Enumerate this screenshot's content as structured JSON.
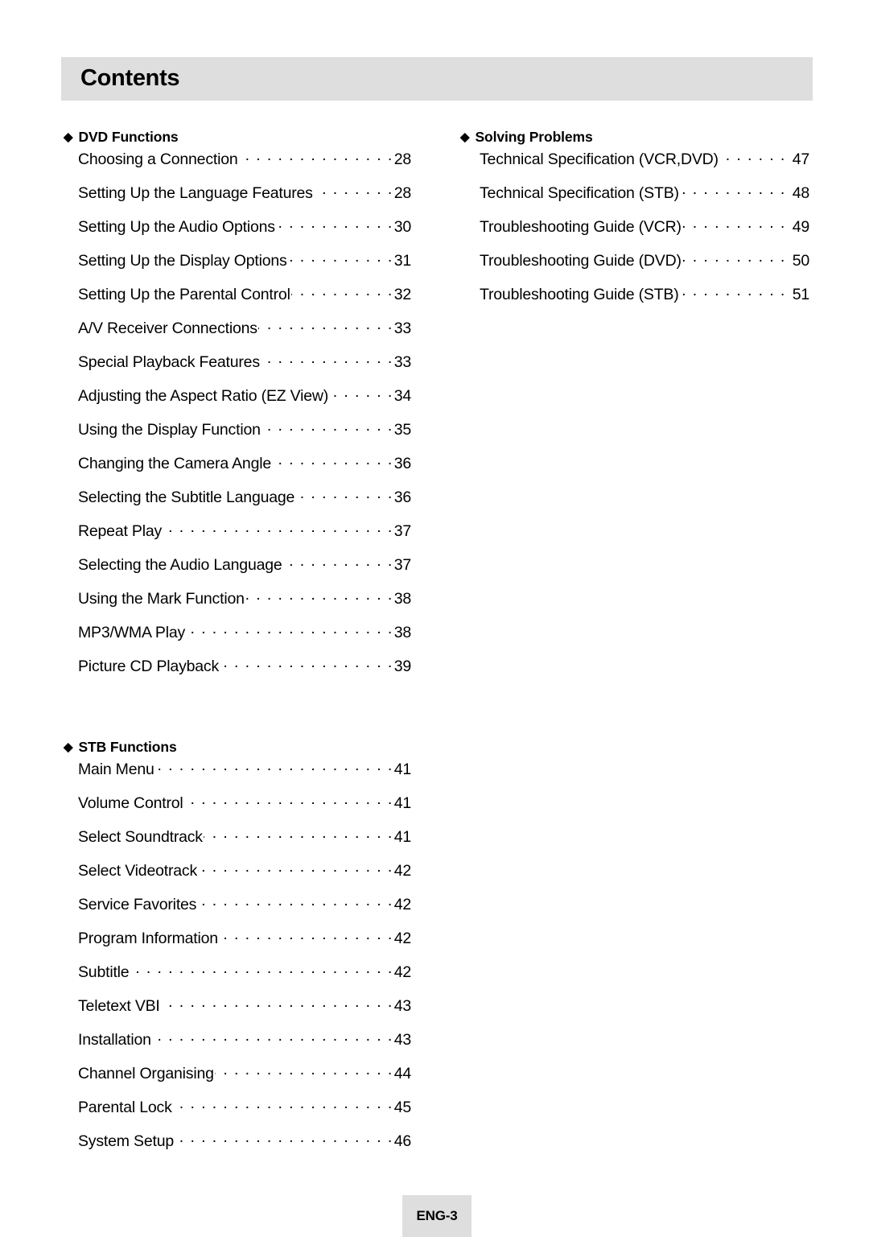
{
  "page": {
    "title": "Contents",
    "badge": "ENG-3",
    "bullet_glyph": "◆",
    "leader_glyph": ".",
    "header_bg": "#dedede",
    "badge_bg": "#dedede",
    "text_color": "#000000",
    "page_bg": "#ffffff"
  },
  "columns": {
    "left": {
      "sections": [
        {
          "heading": "DVD Functions",
          "entries": [
            {
              "label": "Choosing a Connection",
              "page": "28"
            },
            {
              "label": "Setting Up the Language Features",
              "page": "28"
            },
            {
              "label": "Setting Up the Audio Options",
              "page": "30"
            },
            {
              "label": "Setting Up the Display Options",
              "page": "31"
            },
            {
              "label": "Setting Up the Parental Control",
              "page": "32"
            },
            {
              "label": "A/V Receiver Connections",
              "page": "33"
            },
            {
              "label": "Special Playback Features",
              "page": "33"
            },
            {
              "label": "Adjusting the Aspect Ratio (EZ View)",
              "page": "34"
            },
            {
              "label": "Using the Display Function",
              "page": "35"
            },
            {
              "label": "Changing the Camera Angle",
              "page": "36"
            },
            {
              "label": "Selecting the Subtitle Language",
              "page": "36"
            },
            {
              "label": "Repeat Play",
              "page": "37"
            },
            {
              "label": "Selecting the Audio Language",
              "page": "37"
            },
            {
              "label": "Using the Mark Function",
              "page": "38"
            },
            {
              "label": "MP3/WMA Play",
              "page": "38"
            },
            {
              "label": "Picture CD Playback",
              "page": "39"
            }
          ]
        },
        {
          "heading": "STB Functions",
          "entries": [
            {
              "label": "Main Menu",
              "page": "41"
            },
            {
              "label": "Volume Control",
              "page": "41"
            },
            {
              "label": "Select Soundtrack",
              "page": "41"
            },
            {
              "label": "Select Videotrack",
              "page": "42"
            },
            {
              "label": "Service Favorites",
              "page": "42"
            },
            {
              "label": "Program Information",
              "page": "42"
            },
            {
              "label": "Subtitle",
              "page": "42"
            },
            {
              "label": "Teletext VBI",
              "page": "43"
            },
            {
              "label": "Installation",
              "page": "43"
            },
            {
              "label": "Channel Organising",
              "page": "44"
            },
            {
              "label": "Parental Lock",
              "page": "45"
            },
            {
              "label": "System Setup",
              "page": "46"
            }
          ]
        }
      ]
    },
    "right": {
      "sections": [
        {
          "heading": "Solving Problems",
          "entries": [
            {
              "label": "Technical Specification (VCR,DVD)",
              "page": "47"
            },
            {
              "label": "Technical Specification (STB)",
              "page": "48"
            },
            {
              "label": "Troubleshooting Guide (VCR)",
              "page": "49"
            },
            {
              "label": "Troubleshooting Guide (DVD)",
              "page": "50"
            },
            {
              "label": "Troubleshooting Guide (STB)",
              "page": "51"
            }
          ]
        }
      ]
    }
  }
}
